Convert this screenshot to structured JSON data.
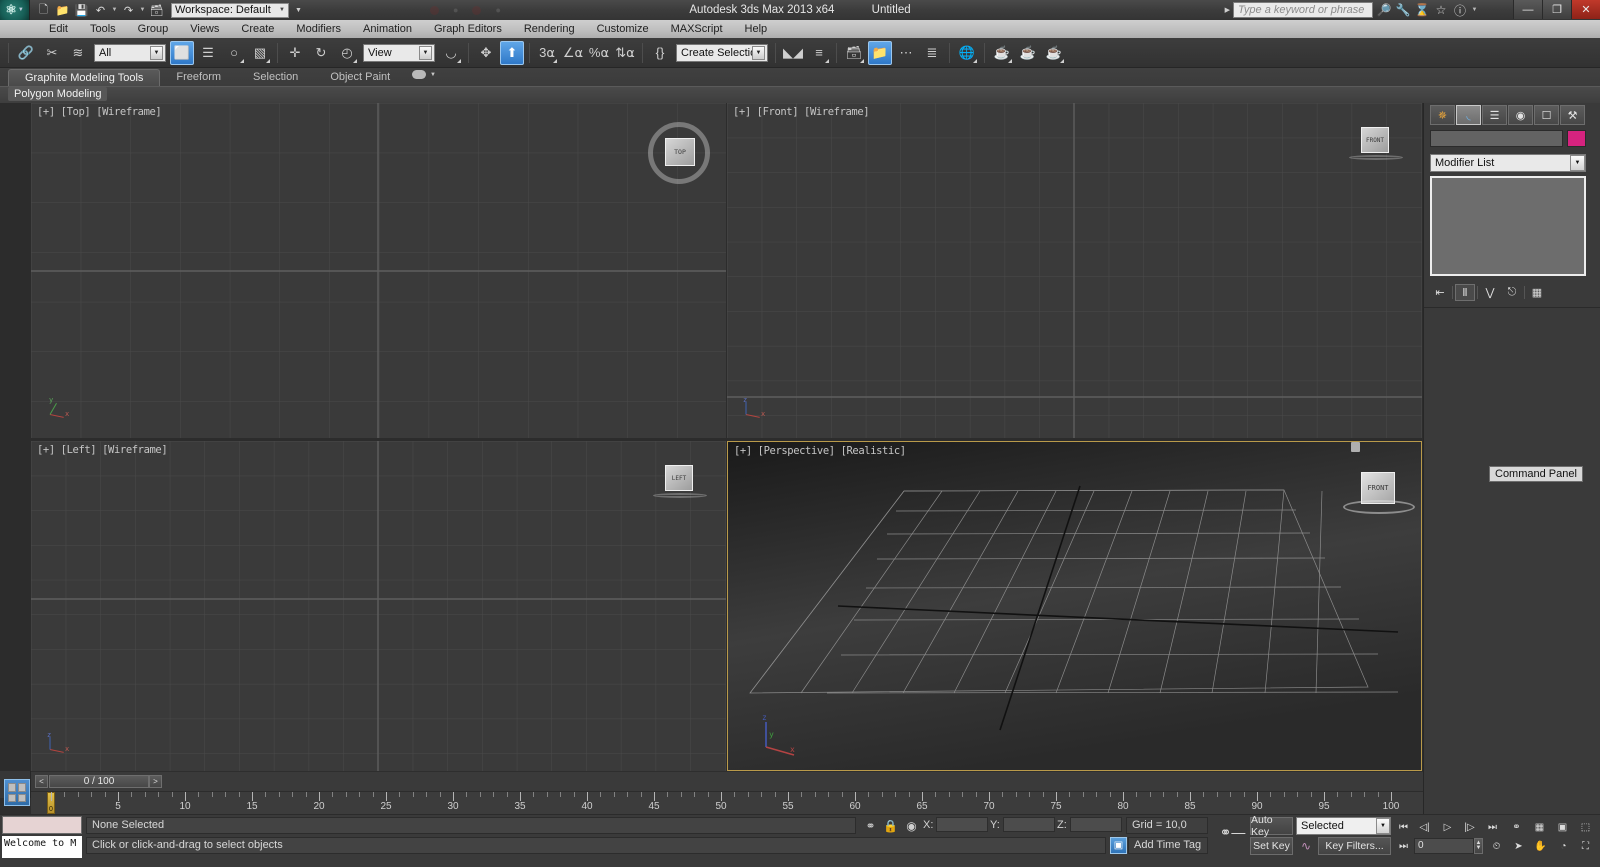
{
  "app": {
    "title": "Autodesk 3ds Max  2013 x64",
    "document": "Untitled",
    "logo_icon": "max-logo-icon"
  },
  "titlebar": {
    "quick_access": [
      {
        "name": "new-file-icon",
        "glyph": "⬚"
      },
      {
        "name": "open-file-icon",
        "glyph": "📂"
      },
      {
        "name": "save-file-icon",
        "glyph": "💾"
      },
      {
        "name": "undo-icon",
        "glyph": "↶"
      },
      {
        "name": "redo-icon",
        "glyph": "↷"
      },
      {
        "name": "project-folder-icon",
        "glyph": "❐"
      }
    ],
    "workspace_label": "Workspace: Default",
    "search_placeholder": "Type a keyword or phrase",
    "help_icons": [
      {
        "name": "binoculars-icon",
        "glyph": "🔍"
      },
      {
        "name": "wrench-icon",
        "glyph": "🔧"
      },
      {
        "name": "hourglass-icon",
        "glyph": "⌛"
      },
      {
        "name": "star-icon",
        "glyph": "☆"
      },
      {
        "name": "help-question-icon",
        "glyph": "?"
      }
    ],
    "window_buttons": [
      {
        "name": "minimize-button",
        "glyph": "–"
      },
      {
        "name": "restore-button",
        "glyph": "❐"
      },
      {
        "name": "close-button",
        "glyph": "✕"
      }
    ]
  },
  "menubar": {
    "items": [
      "Edit",
      "Tools",
      "Group",
      "Views",
      "Create",
      "Modifiers",
      "Animation",
      "Graph Editors",
      "Rendering",
      "Customize",
      "MAXScript",
      "Help"
    ]
  },
  "toolbar": {
    "selection_filter": "All",
    "reference_coord": "View",
    "selection_set_placeholder": "Create Selection Se",
    "buttons": [
      {
        "name": "select-and-link-icon",
        "glyph": "🔗",
        "active": false
      },
      {
        "name": "unlink-selection-icon",
        "glyph": "✂",
        "active": false
      },
      {
        "name": "bind-to-space-warp-icon",
        "glyph": "≋",
        "active": false
      },
      {
        "name": "select-object-icon",
        "glyph": "⬜",
        "active": true
      },
      {
        "name": "select-by-name-icon",
        "glyph": "☰",
        "active": false
      },
      {
        "name": "select-region-circle-icon",
        "glyph": "○",
        "active": false
      },
      {
        "name": "window-crossing-icon",
        "glyph": "▧",
        "active": false
      },
      {
        "name": "select-and-move-icon",
        "glyph": "✛",
        "active": false
      },
      {
        "name": "select-and-rotate-icon",
        "glyph": "↻",
        "active": false
      },
      {
        "name": "select-and-scale-icon",
        "glyph": "◤",
        "active": false
      },
      {
        "name": "use-pivot-center-icon",
        "glyph": "⬛",
        "active": false
      },
      {
        "name": "mirror-icon",
        "glyph": "⬌",
        "active": false
      },
      {
        "name": "align-icon",
        "glyph": "⬆",
        "active": true
      },
      {
        "name": "snap-toggle-3-icon",
        "glyph": "3",
        "active": false
      },
      {
        "name": "angle-snap-icon",
        "glyph": "∠",
        "active": false
      },
      {
        "name": "percent-snap-icon",
        "glyph": "%",
        "active": false
      },
      {
        "name": "spinner-snap-icon",
        "glyph": "↕",
        "active": false
      },
      {
        "name": "named-selection-sets-icon",
        "glyph": "{}",
        "active": false
      },
      {
        "name": "mirror-tool-icon",
        "glyph": "⧉",
        "active": false
      },
      {
        "name": "align-tool-icon",
        "glyph": "≡",
        "active": false
      },
      {
        "name": "layer-manager-icon",
        "glyph": "☰",
        "active": false
      },
      {
        "name": "scene-explorer-icon",
        "glyph": "📁",
        "active": true
      },
      {
        "name": "curve-editor-icon",
        "glyph": "⌇",
        "active": false
      },
      {
        "name": "schematic-view-icon",
        "glyph": "☰",
        "active": false
      },
      {
        "name": "material-editor-icon",
        "glyph": "◎",
        "active": false
      },
      {
        "name": "render-setup-icon",
        "glyph": "☕",
        "active": false
      },
      {
        "name": "rendered-frame-icon",
        "glyph": "☕",
        "active": false
      },
      {
        "name": "render-production-icon",
        "glyph": "☕",
        "active": false
      }
    ]
  },
  "ribbon": {
    "tabs": [
      {
        "label": "Graphite Modeling Tools",
        "active": true
      },
      {
        "label": "Freeform",
        "active": false
      },
      {
        "label": "Selection",
        "active": false
      },
      {
        "label": "Object Paint",
        "active": false
      }
    ],
    "panel_name": "Polygon Modeling"
  },
  "viewports": [
    {
      "name": "viewport-top",
      "label": "[+] [Top] [Wireframe]",
      "shading": "wireframe",
      "active": false
    },
    {
      "name": "viewport-front",
      "label": "[+] [Front] [Wireframe]",
      "shading": "wireframe",
      "active": false
    },
    {
      "name": "viewport-left",
      "label": "[+] [Left] [Wireframe]",
      "shading": "wireframe",
      "active": false
    },
    {
      "name": "viewport-perspective",
      "label": "[+] [Perspective] [Realistic]",
      "shading": "realistic",
      "active": true
    }
  ],
  "viewcubes": [
    {
      "name": "viewcube-top",
      "face": "TOP"
    },
    {
      "name": "viewcube-front",
      "face": "FRONT"
    },
    {
      "name": "viewcube-left",
      "face": "LEFT"
    },
    {
      "name": "viewcube-persp",
      "face": "FRONT"
    }
  ],
  "command_panel": {
    "tabs": [
      {
        "name": "create-tab",
        "glyph": "☀",
        "selected": false
      },
      {
        "name": "modify-tab",
        "glyph": "◜",
        "selected": true
      },
      {
        "name": "hierarchy-tab",
        "glyph": "⚓",
        "selected": false
      },
      {
        "name": "motion-tab",
        "glyph": "◎",
        "selected": false
      },
      {
        "name": "display-tab",
        "glyph": "▣",
        "selected": false
      },
      {
        "name": "utilities-tab",
        "glyph": "⚒",
        "selected": false
      }
    ],
    "object_name": "",
    "object_color": "#d6237f",
    "modifier_list_label": "Modifier List",
    "stack_buttons": [
      {
        "name": "pin-stack-icon",
        "glyph": "⇥"
      },
      {
        "name": "show-end-result-icon",
        "glyph": "Ⅱ"
      },
      {
        "name": "make-unique-icon",
        "glyph": "⅄"
      },
      {
        "name": "remove-modifier-icon",
        "glyph": "⛃"
      },
      {
        "name": "configure-modifier-sets-icon",
        "glyph": "▦"
      }
    ],
    "tooltip": "Command Panel"
  },
  "timeline": {
    "current_frame_label": "0 / 100",
    "prev_frame_glyph": "<",
    "next_frame_glyph": ">",
    "ruler_labels": [
      "5",
      "10",
      "15",
      "20",
      "25",
      "30",
      "35",
      "40",
      "45",
      "50",
      "55",
      "60",
      "65",
      "70",
      "75",
      "80",
      "85",
      "90",
      "95",
      "100"
    ],
    "ruler_start": 0,
    "ruler_end": 100
  },
  "statusbar": {
    "maxscript_listener_text": "Welcome to M",
    "selection_status": "None Selected",
    "prompt": "Click or click-and-drag to select objects",
    "icons": [
      {
        "name": "isolate-selection-icon",
        "glyph": "♀"
      },
      {
        "name": "selection-lock-icon",
        "glyph": "🔒"
      },
      {
        "name": "absolute-relative-mode-icon",
        "glyph": "◉"
      }
    ],
    "coords": [
      {
        "name": "coord-x",
        "label": "X:",
        "value": ""
      },
      {
        "name": "coord-y",
        "label": "Y:",
        "value": ""
      },
      {
        "name": "coord-z",
        "label": "Z:",
        "value": ""
      }
    ],
    "grid_label": "Grid = 10,0",
    "add_time_tag": "Add Time Tag",
    "key_mode_icon": "key-mode-toggle-icon"
  },
  "animation": {
    "auto_key_label": "Auto Key",
    "set_key_label": "Set Key",
    "key_filter_label": "Key Filters...",
    "selection_level": "Selected",
    "frame_value": "0",
    "playback_buttons": [
      {
        "name": "goto-start-button",
        "glyph": "⏮"
      },
      {
        "name": "previous-frame-button",
        "glyph": "◁"
      },
      {
        "name": "play-animation-button",
        "glyph": "▷"
      },
      {
        "name": "next-frame-button",
        "glyph": "▷"
      },
      {
        "name": "goto-end-button",
        "glyph": "⏭"
      },
      {
        "name": "key-mode-button",
        "glyph": "◉"
      },
      {
        "name": "time-configuration-button",
        "glyph": "⊞"
      },
      {
        "name": "zoom-extents-selected-button",
        "glyph": "▣"
      },
      {
        "name": "zoom-extents-all-button",
        "glyph": "⬚"
      }
    ],
    "nav_buttons": [
      {
        "name": "current-frame-button",
        "glyph": "⏭"
      },
      {
        "name": "time-config-button",
        "glyph": "⌚"
      },
      {
        "name": "pan-view-button",
        "glyph": "➤"
      },
      {
        "name": "hand-pan-button",
        "glyph": "✋"
      },
      {
        "name": "orbit-button",
        "glyph": "◔"
      },
      {
        "name": "maximize-viewport-button",
        "glyph": "⛶"
      }
    ]
  }
}
